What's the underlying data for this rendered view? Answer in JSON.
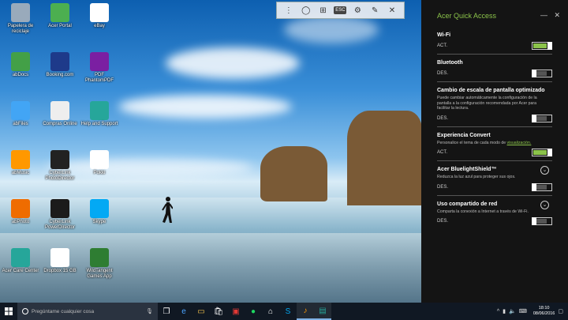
{
  "desktop": {
    "icons": [
      {
        "label": "Papelera de reciclaje",
        "icon": "recycle-bin-icon",
        "color": "#9ab"
      },
      {
        "label": "Acer Portal",
        "icon": "acer-portal-icon",
        "color": "#4caf50"
      },
      {
        "label": "eBay",
        "icon": "ebay-icon",
        "color": "#ffffff"
      },
      {
        "label": "abDocs",
        "icon": "abdocs-icon",
        "color": "#43a047"
      },
      {
        "label": "Booking.com",
        "icon": "booking-icon",
        "color": "#1e3a8a"
      },
      {
        "label": "PDF PhantomPDF",
        "icon": "pdf-icon",
        "color": "#7b1fa2"
      },
      {
        "label": "abFiles",
        "icon": "abfiles-icon",
        "color": "#42a5f5"
      },
      {
        "label": "Compras Online",
        "icon": "acer-store-icon",
        "color": "#eeeeee"
      },
      {
        "label": "Help and Support",
        "icon": "help-icon",
        "color": "#26a69a"
      },
      {
        "label": "abMusic",
        "icon": "abmusic-icon",
        "color": "#ff9800"
      },
      {
        "label": "CyberLink PhotoDirector",
        "icon": "photodirector-icon",
        "color": "#222222"
      },
      {
        "label": "Pokki",
        "icon": "pokki-icon",
        "color": "#ffffff"
      },
      {
        "label": "abPhoto",
        "icon": "abphoto-icon",
        "color": "#ef6c00"
      },
      {
        "label": "CyberLink PowerDirector",
        "icon": "powerdirector-icon",
        "color": "#1b1b1b"
      },
      {
        "label": "Skype",
        "icon": "skype-icon",
        "color": "#03a9f4"
      },
      {
        "label": "Acer Care Center",
        "icon": "care-center-icon",
        "color": "#26a69a"
      },
      {
        "label": "Dropbox 15 GB",
        "icon": "dropbox-icon",
        "color": "#ffffff"
      },
      {
        "label": "WildTangent Games App",
        "icon": "wildtangent-icon",
        "color": "#2e7d32"
      }
    ]
  },
  "toolbar": {
    "esc_label": "ESC"
  },
  "panel": {
    "title": "Acer Quick Access",
    "accent": "#8bc34a",
    "settings": [
      {
        "title": "Wi-Fi",
        "desc": "",
        "state": "ACT.",
        "on": true
      },
      {
        "title": "Bluetooth",
        "desc": "",
        "state": "DES.",
        "on": false
      },
      {
        "title": "Cambio de escala de pantalla optimizado",
        "desc": "Puede cambiar automáticamente la configuración de la pantalla a la configuración recomendada por Acer para facilitar la lectura.",
        "state": "DES.",
        "on": false
      },
      {
        "title": "Experiencia Convert",
        "desc": "Personalice el tema de cada modo de ",
        "link": "visualización.",
        "state": "ACT.",
        "on": true
      },
      {
        "title": "Acer BluelightShield™",
        "desc": "Reduzca la luz azul para proteger sus ojos.",
        "state": "DES.",
        "on": false
      },
      {
        "title": "Uso compartido de red",
        "desc": "Comparta la conexión a Internet a través de Wi-Fi.",
        "state": "DES.",
        "on": false
      }
    ]
  },
  "taskbar": {
    "search_placeholder": "Pregúntame cualquier cosa",
    "time": "18:10",
    "date": "08/06/2016"
  }
}
